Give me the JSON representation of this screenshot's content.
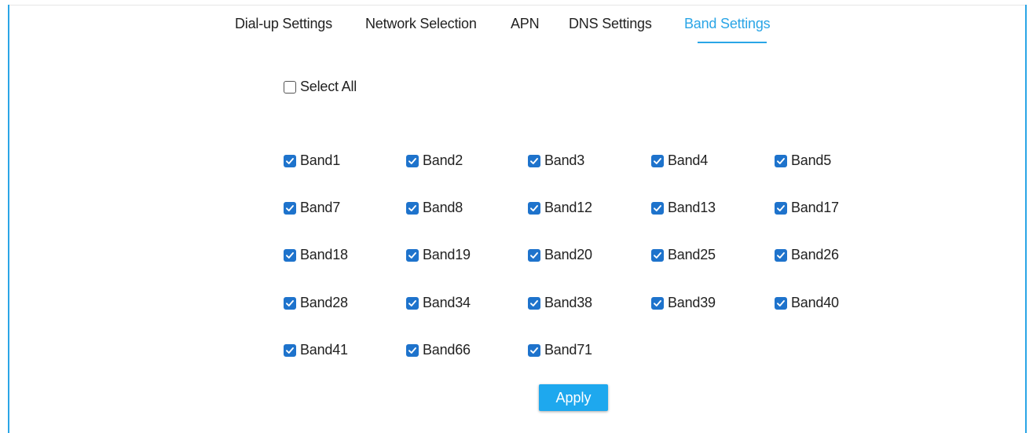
{
  "tabs": [
    {
      "label": "Dial-up Settings",
      "active": false
    },
    {
      "label": "Network Selection",
      "active": false
    },
    {
      "label": "APN",
      "active": false
    },
    {
      "label": "DNS Settings",
      "active": false
    },
    {
      "label": "Band Settings",
      "active": true
    }
  ],
  "select_all": {
    "label": "Select All",
    "checked": false
  },
  "bands": [
    {
      "label": "Band1",
      "checked": true
    },
    {
      "label": "Band2",
      "checked": true
    },
    {
      "label": "Band3",
      "checked": true
    },
    {
      "label": "Band4",
      "checked": true
    },
    {
      "label": "Band5",
      "checked": true
    },
    {
      "label": "Band7",
      "checked": true
    },
    {
      "label": "Band8",
      "checked": true
    },
    {
      "label": "Band12",
      "checked": true
    },
    {
      "label": "Band13",
      "checked": true
    },
    {
      "label": "Band17",
      "checked": true
    },
    {
      "label": "Band18",
      "checked": true
    },
    {
      "label": "Band19",
      "checked": true
    },
    {
      "label": "Band20",
      "checked": true
    },
    {
      "label": "Band25",
      "checked": true
    },
    {
      "label": "Band26",
      "checked": true
    },
    {
      "label": "Band28",
      "checked": true
    },
    {
      "label": "Band34",
      "checked": true
    },
    {
      "label": "Band38",
      "checked": true
    },
    {
      "label": "Band39",
      "checked": true
    },
    {
      "label": "Band40",
      "checked": true
    },
    {
      "label": "Band41",
      "checked": true
    },
    {
      "label": "Band66",
      "checked": true
    },
    {
      "label": "Band71",
      "checked": true
    }
  ],
  "apply_button": {
    "label": "Apply"
  },
  "colors": {
    "accent": "#2aa5e6",
    "checkbox_checked": "#1e73cc",
    "button_bg": "#1ea8ee",
    "text": "#222222"
  }
}
